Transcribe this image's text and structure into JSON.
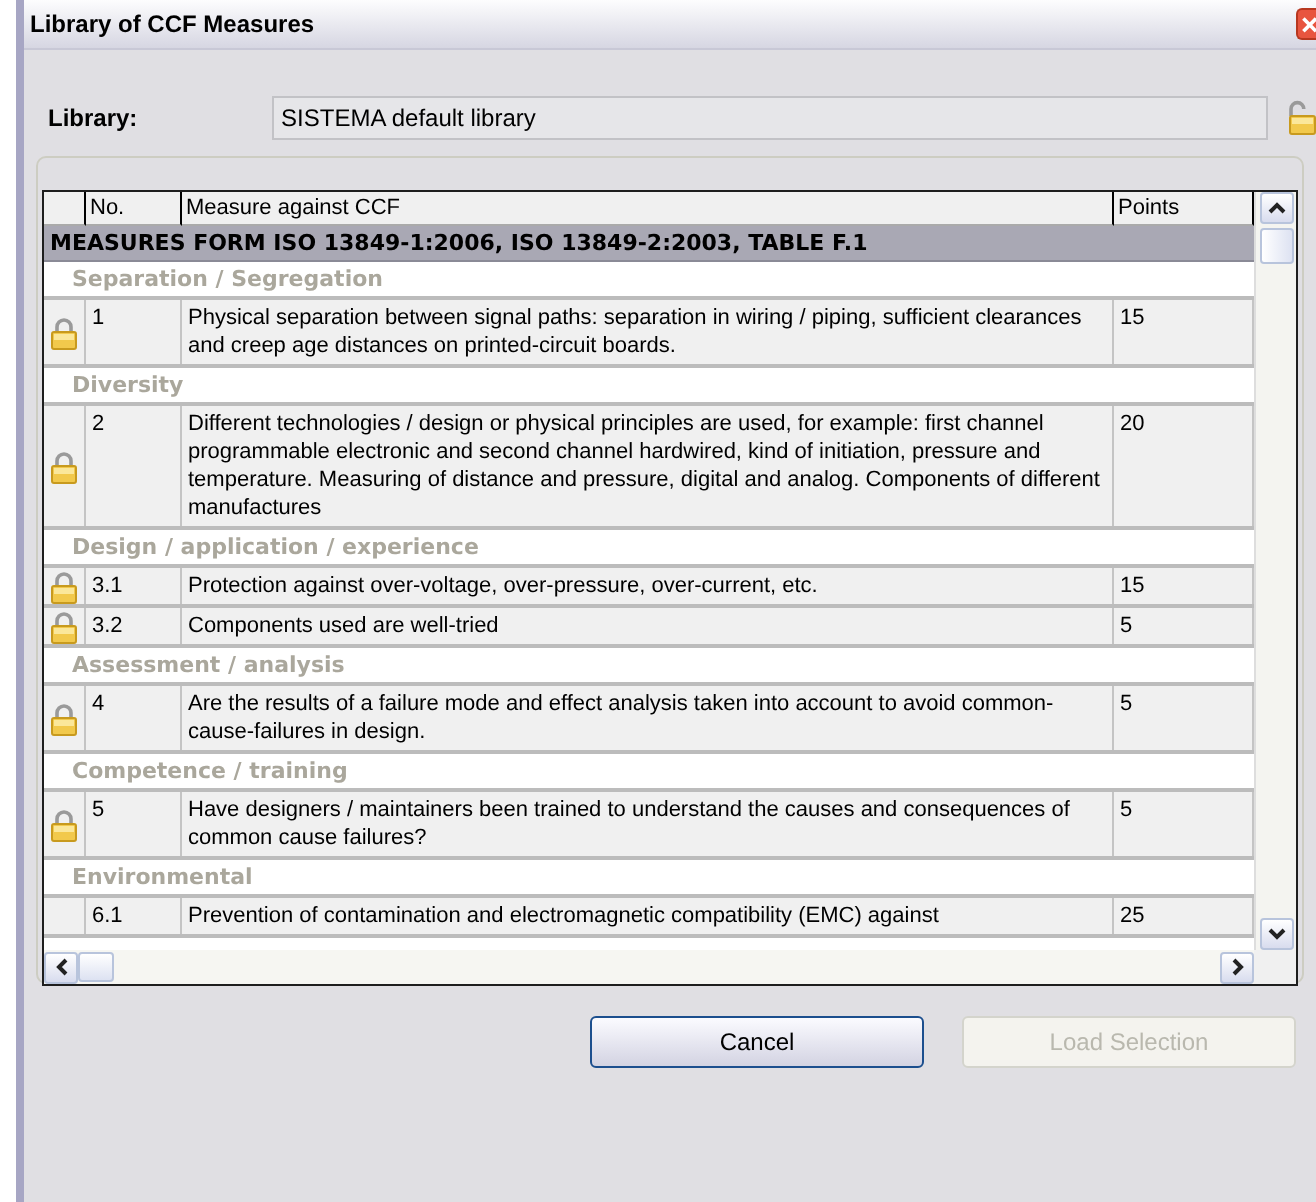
{
  "window": {
    "title": "Library of CCF Measures"
  },
  "library": {
    "label": "Library:",
    "value": "SISTEMA default library"
  },
  "table": {
    "columns": [
      "No.",
      "Measure against CCF",
      "Points"
    ],
    "title_row": "MEASURES FORM ISO 13849-1:2006, ISO 13849-2:2003, TABLE F.1",
    "rows": [
      {
        "kind": "category",
        "label": "Separation / Segregation"
      },
      {
        "kind": "measure",
        "locked": true,
        "no": "1",
        "measure": "Physical separation between signal paths: separation in wiring / piping, sufficient clearances and creep age distances on printed-circuit boards.",
        "points": "15"
      },
      {
        "kind": "category",
        "label": "Diversity"
      },
      {
        "kind": "measure",
        "locked": true,
        "no": "2",
        "measure": "Different technologies / design or physical principles are used, for example: first channel programmable electronic and second channel hardwired, kind of initiation, pressure and temperature. Measuring of distance and pressure, digital and analog. Components of different manufactures",
        "points": "20"
      },
      {
        "kind": "category",
        "label": "Design / application / experience"
      },
      {
        "kind": "measure",
        "locked": true,
        "no": "3.1",
        "measure": "Protection against over-voltage, over-pressure, over-current, etc.",
        "points": "15"
      },
      {
        "kind": "measure",
        "locked": true,
        "no": "3.2",
        "measure": "Components used are well-tried",
        "points": "5"
      },
      {
        "kind": "category",
        "label": "Assessment / analysis"
      },
      {
        "kind": "measure",
        "locked": true,
        "no": "4",
        "measure": "Are the results of a failure mode and effect analysis taken into account to avoid common-cause-failures in design.",
        "points": "5"
      },
      {
        "kind": "category",
        "label": "Competence / training"
      },
      {
        "kind": "measure",
        "locked": true,
        "no": "5",
        "measure": "Have designers / maintainers been trained to understand the causes and consequences of common cause failures?",
        "points": "5"
      },
      {
        "kind": "category",
        "label": "Environmental"
      },
      {
        "kind": "measure",
        "locked": false,
        "no": "6.1",
        "measure": "Prevention of contamination and electromagnetic compatibility (EMC) against",
        "points": "25"
      }
    ]
  },
  "buttons": [
    {
      "label": "Cancel",
      "disabled": false
    },
    {
      "label": "Load Selection",
      "disabled": true
    }
  ]
}
